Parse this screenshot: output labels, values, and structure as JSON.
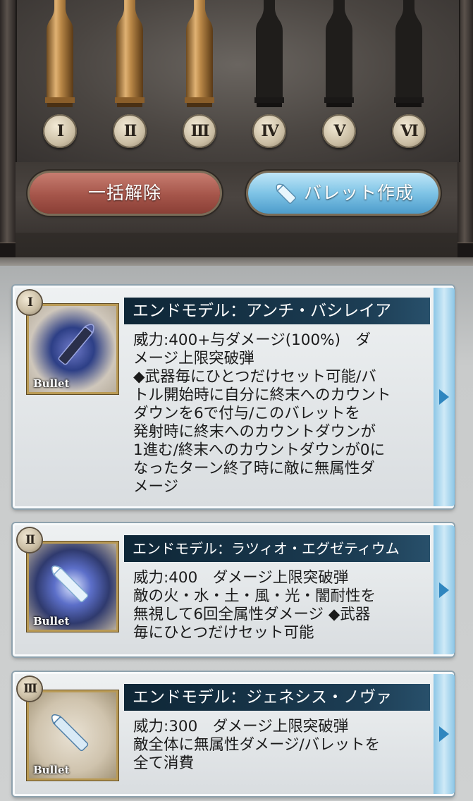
{
  "slots": [
    {
      "numeral": "I",
      "filled": true
    },
    {
      "numeral": "II",
      "filled": true
    },
    {
      "numeral": "III",
      "filled": true
    },
    {
      "numeral": "IV",
      "filled": false
    },
    {
      "numeral": "V",
      "filled": false
    },
    {
      "numeral": "VI",
      "filled": false
    }
  ],
  "buttons": {
    "release_all": "一括解除",
    "create_bullet": "バレット作成"
  },
  "bullets": [
    {
      "rank": "I",
      "title": "エンドモデル：アンチ・バシレイア",
      "thumb_label": "Bullet",
      "description": "威力:400+与ダメージ(100%)　ダ\nメージ上限突破弾\n◆武器毎にひとつだけセット可能/バ\nトル開始時に自分に終末へのカウント\nダウンを6で付与/このバレットを\n発射時に終末へのカウントダウンが\n1進む/終末へのカウントダウンが0に\nなったターン終了時に敵に無属性ダ\nメージ"
    },
    {
      "rank": "II",
      "title": "エンドモデル：ラツィオ・エグゼティウム",
      "thumb_label": "Bullet",
      "description": "威力:400　ダメージ上限突破弾\n敵の火・水・土・風・光・闇耐性を\n無視して6回全属性ダメージ ◆武器\n毎にひとつだけセット可能"
    },
    {
      "rank": "III",
      "title": "エンドモデル：ジェネシス・ノヴァ",
      "thumb_label": "Bullet",
      "description": "威力:300　ダメージ上限突破弾\n敵全体に無属性ダメージ/バレットを\n全て消費"
    }
  ]
}
